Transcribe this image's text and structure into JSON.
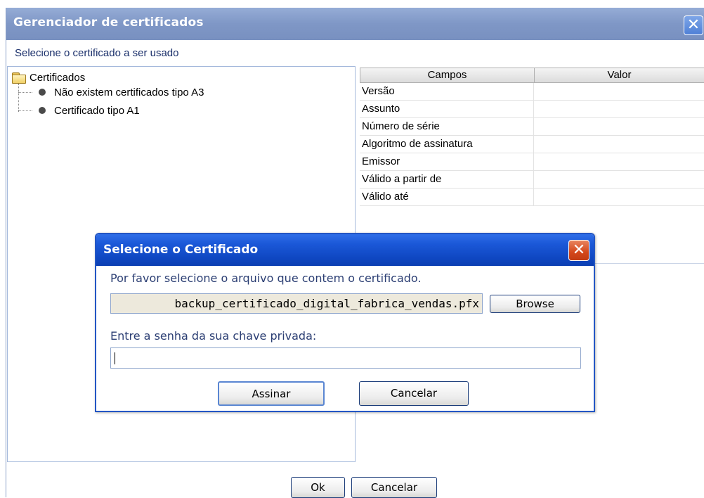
{
  "main_window": {
    "title": "Gerenciador de certificados",
    "close_glyph": "✕",
    "select_label": "Selecione o certificado a ser usado",
    "tree": {
      "root_label": "Certificados",
      "root_icon": "folder-icon",
      "children": [
        {
          "label": "Não existem certificados tipo A3",
          "icon": "bullet-icon"
        },
        {
          "label": "Certificado tipo A1",
          "icon": "bullet-icon"
        }
      ]
    },
    "details_table": {
      "columns": [
        "Campos",
        "Valor"
      ],
      "rows": [
        {
          "field": "Versão",
          "value": ""
        },
        {
          "field": "Assunto",
          "value": ""
        },
        {
          "field": "Número de série",
          "value": ""
        },
        {
          "field": "Algoritmo de assinatura",
          "value": ""
        },
        {
          "field": "Emissor",
          "value": ""
        },
        {
          "field": "Válido a partir de",
          "value": ""
        },
        {
          "field": "Válido até",
          "value": ""
        }
      ]
    },
    "buttons": {
      "ok": "Ok",
      "cancel": "Cancelar"
    }
  },
  "dialog": {
    "title": "Selecione o Certificado",
    "close_glyph": "✕",
    "file_prompt": "Por favor selecione o arquivo que contem o certificado.",
    "file_value": "backup_certificado_digital_fabrica_vendas.pfx",
    "browse_label": "Browse",
    "password_label": "Entre a senha da sua chave privada:",
    "password_value": "",
    "sign_label": "Assinar",
    "cancel_label": "Cancelar"
  },
  "colors": {
    "main_titlebar": "#7f97c6",
    "dialog_titlebar": "#1b58d8",
    "dialog_close": "#d4471a",
    "prompt_text": "#2b3e73"
  }
}
